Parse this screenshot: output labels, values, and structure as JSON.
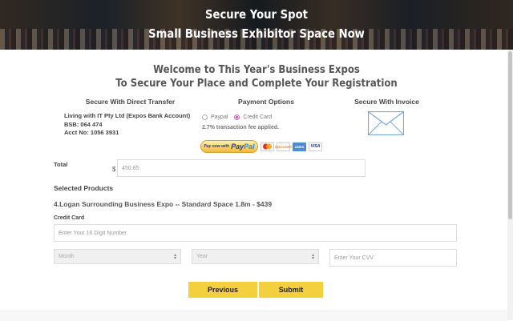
{
  "hero": {
    "title_line1": "Secure Your Spot",
    "title_line2": "Small Business Exhibitor Space Now"
  },
  "welcome": {
    "line1": "Welcome to This Year's Business Expos",
    "line2": "To Secure Your Place and Complete Your Registration"
  },
  "columns": {
    "transfer_heading": "Secure With Direct Transfer",
    "options_heading": "Payment Options",
    "invoice_heading": "Secure With Invoice"
  },
  "bank": {
    "name": "Living with IT Pty Ltd (Expos Bank Account)",
    "bsb": "BSB: 064 474",
    "acct": "Acct No: 1056 3931"
  },
  "payment_options": {
    "paypal_label": "Paypal",
    "credit_card_label": "Credit Card",
    "selected": "Credit Card",
    "fee_note": "2.7% transaction fee applied."
  },
  "logos": {
    "paypal_button_small": "Pay now with",
    "paypal_word_a": "Pay",
    "paypal_word_b": "Pal",
    "discover": "DISCOVER",
    "visa": "VISA",
    "amex": "AMEX"
  },
  "total": {
    "label": "Total",
    "currency": "$",
    "value": "450.85"
  },
  "selected_products": {
    "heading": "Selected Products",
    "item": "4.Logan Surrounding Business Expo -- Standard Space 1.8m - $439"
  },
  "credit_card": {
    "label": "Credit Card",
    "number_placeholder": "Enter Your 16 Digit Number",
    "month_placeholder": "Month",
    "year_placeholder": "Year",
    "cvv_placeholder": "Enter Your CVV"
  },
  "buttons": {
    "previous": "Previous",
    "submit": "Submit"
  },
  "colors": {
    "button_yellow": "#f4d03f",
    "radio_accent": "#c66bb1"
  },
  "icons": [
    "envelope-icon",
    "paypal-logo",
    "mastercard-logo",
    "discover-logo",
    "amex-logo",
    "visa-logo",
    "select-arrows-icon"
  ]
}
